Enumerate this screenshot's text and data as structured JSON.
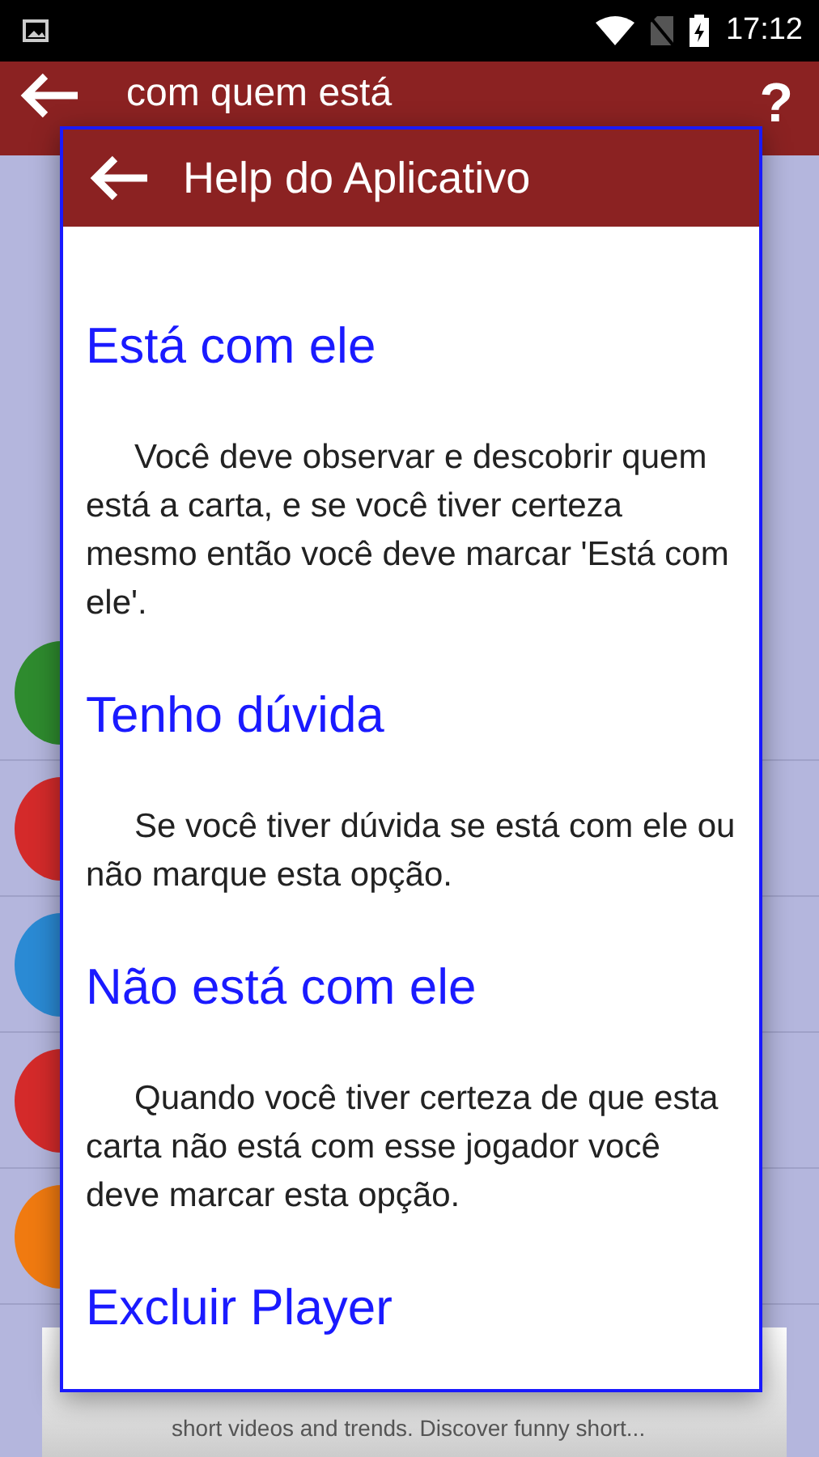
{
  "status_bar": {
    "time": "17:12"
  },
  "app_bar": {
    "title": "com quem está",
    "help": "?"
  },
  "rows": [
    {
      "color": "#2e8b2e"
    },
    {
      "color": "#d42a2a"
    },
    {
      "color": "#2a8ad4"
    },
    {
      "color": "#d42a2a"
    },
    {
      "color": "#f07a10"
    }
  ],
  "ad": {
    "text": "short videos and trends. Discover funny short..."
  },
  "dialog": {
    "title": "Help do Aplicativo",
    "sections": [
      {
        "heading": "Está com ele",
        "body": "Você deve observar e descobrir quem está a carta, e se você tiver certeza mesmo então você deve marcar 'Está com ele'."
      },
      {
        "heading": "Tenho dúvida",
        "body": "Se você tiver dúvida se está com ele ou não marque esta opção."
      },
      {
        "heading": "Não está com ele",
        "body": "Quando você tiver certeza de que esta carta não está com esse jogador você deve marcar esta opção."
      },
      {
        "heading": "Excluir Player"
      }
    ]
  }
}
